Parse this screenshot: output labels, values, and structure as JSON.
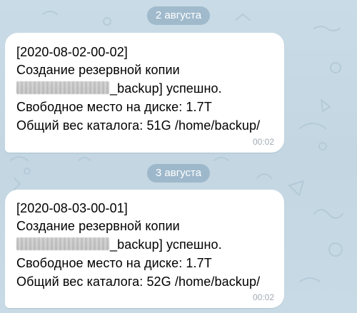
{
  "chat": {
    "date_1": "2 августа",
    "date_2": "3 августа",
    "messages": [
      {
        "header": "[2020-08-02-00-02]",
        "line2": "Создание резервной копии",
        "line3_suffix": "_backup] успешно.",
        "line4": "Свободное место на диске: 1.7T",
        "line5": "Общий вес каталога: 51G /home/backup/",
        "time": "00:02"
      },
      {
        "header": "[2020-08-03-00-01]",
        "line2": "Создание резервной копии",
        "line3_suffix": "_backup] успешно.",
        "line4": "Свободное место на диске: 1.7T",
        "line5": "Общий вес каталога: 52G /home/backup/",
        "time": "00:02"
      }
    ]
  },
  "colors": {
    "background": "#c7d9e4",
    "date_pill": "#8fb0c8",
    "bubble": "#ffffff",
    "timestamp": "#a0aab3"
  }
}
